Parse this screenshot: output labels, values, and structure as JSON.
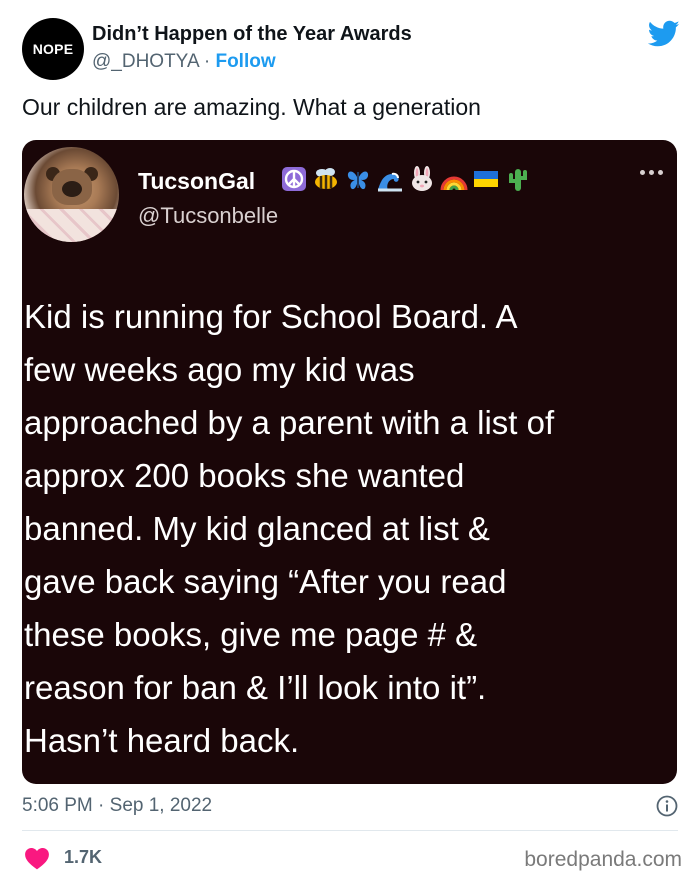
{
  "header": {
    "avatar_text": "NOPE",
    "account_name": "Didn’t Happen of the Year Awards",
    "handle": "@_DHOTYA",
    "separator": " · ",
    "follow_label": "Follow"
  },
  "tweet": {
    "text": "Our children are amazing. What a generation"
  },
  "embedded": {
    "name": "TucsonGal",
    "emojis": [
      "peace-symbol",
      "bee",
      "butterfly",
      "wave",
      "rabbit",
      "rainbow",
      "ukraine-flag",
      "cactus"
    ],
    "handle": "@Tucsonbelle",
    "body_lines": [
      "Kid is running for School Board. A",
      "few weeks ago my kid was",
      "approached by a parent with a list of",
      "approx 200 books she wanted",
      "banned. My kid glanced at list &",
      "gave back saying “After you read",
      "these books, give me page # &",
      "reason for ban & I’ll look into it”.",
      "Hasn’t heard back."
    ]
  },
  "footer": {
    "timestamp": "5:06 PM · Sep 1, 2022",
    "like_count": "1.7K",
    "watermark": "boredpanda.com"
  },
  "colors": {
    "accent": "#1d9bf0",
    "like": "#f91880",
    "card_bg": "#1a0608"
  }
}
